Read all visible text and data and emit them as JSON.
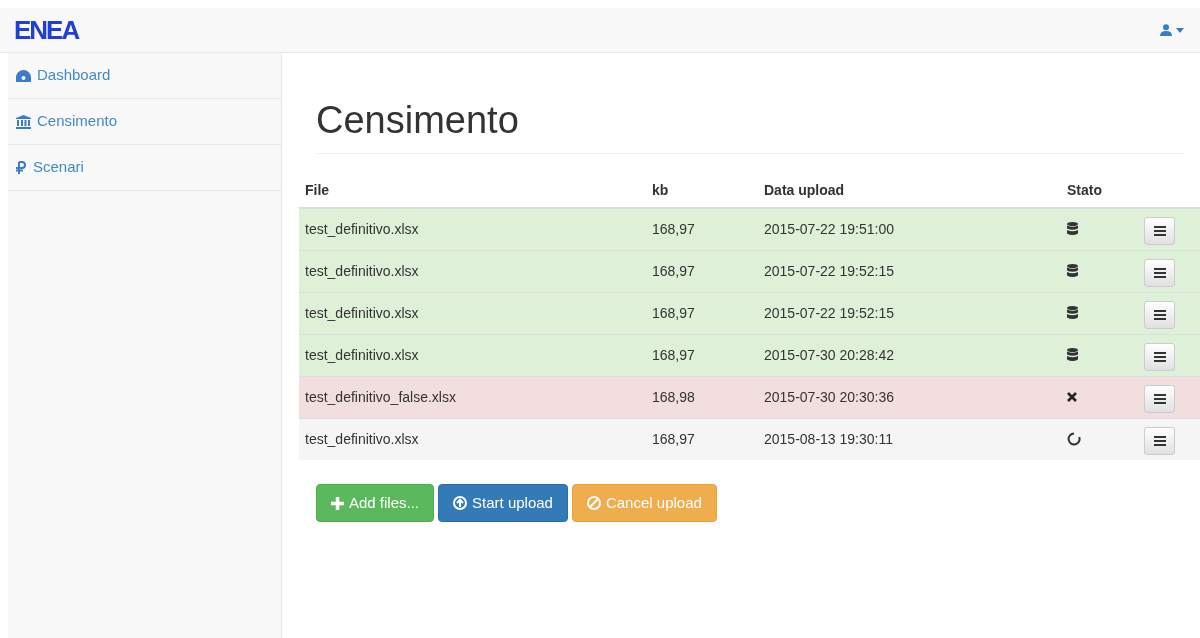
{
  "brand": {
    "logo": "ENEA"
  },
  "sidebar": {
    "items": [
      {
        "label": "Dashboard"
      },
      {
        "label": "Censimento"
      },
      {
        "label": "Scenari"
      }
    ]
  },
  "page_title": "Censimento",
  "table": {
    "columns": [
      "File",
      "kb",
      "Data upload",
      "Stato"
    ],
    "rows": [
      {
        "file": "test_definitivo.xlsx",
        "kb": "168,97",
        "date": "2015-07-22 19:51:00",
        "kind": "stored"
      },
      {
        "file": "test_definitivo.xlsx",
        "kb": "168,97",
        "date": "2015-07-22 19:52:15",
        "kind": "stored"
      },
      {
        "file": "test_definitivo.xlsx",
        "kb": "168,97",
        "date": "2015-07-22 19:52:15",
        "kind": "stored"
      },
      {
        "file": "test_definitivo.xlsx",
        "kb": "168,97",
        "date": "2015-07-30 20:28:42",
        "kind": "stored"
      },
      {
        "file": "test_definitivo_false.xlsx",
        "kb": "168,98",
        "date": "2015-07-30 20:30:36",
        "kind": "error"
      },
      {
        "file": "test_definitivo.xlsx",
        "kb": "168,97",
        "date": "2015-08-13 19:30:11",
        "kind": "pending"
      }
    ]
  },
  "buttons": [
    {
      "label": "Add files...",
      "kind": "add"
    },
    {
      "label": "Start upload",
      "kind": "start"
    },
    {
      "label": "Cancel upload",
      "kind": "cancel"
    }
  ]
}
